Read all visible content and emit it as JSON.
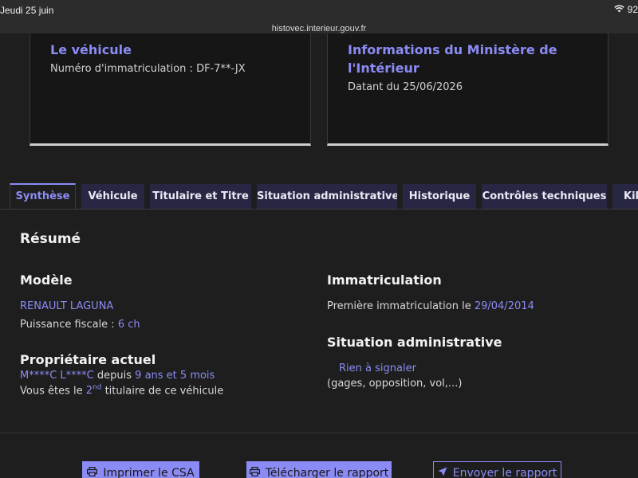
{
  "status_bar": {
    "time": "Jeudi 25 juin",
    "battery": "92"
  },
  "browser": {
    "url": "histovec.interieur.gouv.fr"
  },
  "cards": {
    "vehicle": {
      "title": "Le véhicule",
      "plate_label": "Numéro d'immatriculation : DF-7**-JX"
    },
    "ministry": {
      "title_line1": "Informations du Ministère de",
      "title_line2": "l'Intérieur",
      "date_text": "Datant du 25/06/2026"
    }
  },
  "tabs": [
    {
      "label": "Synthèse",
      "active": true
    },
    {
      "label": "Véhicule"
    },
    {
      "label": "Titulaire et Titre"
    },
    {
      "label": "Situation administrative"
    },
    {
      "label": "Historique"
    },
    {
      "label": "Contrôles techniques"
    },
    {
      "label": "Kilo"
    }
  ],
  "summary": {
    "title": "Résumé",
    "model": {
      "heading": "Modèle",
      "name": "RENAULT LAGUNA",
      "power_label": "Puissance fiscale :",
      "power_value": "6 ch"
    },
    "owner": {
      "heading": "Propriétaire actuel",
      "name": "M****C L****C",
      "since_label": "depuis",
      "since_value": "9 ans et 5 mois",
      "rank_prefix": "Vous êtes le",
      "rank_number": "2",
      "rank_sup": "nd",
      "rank_suffix": "titulaire de ce véhicule"
    },
    "registration": {
      "heading": "Immatriculation",
      "first_label": "Première immatriculation le",
      "first_date": "29/04/2014"
    },
    "admin": {
      "heading": "Situation administrative",
      "status": "Rien à signaler",
      "detail": "(gages, opposition, vol,...)"
    }
  },
  "actions": {
    "print": "Imprimer le CSA",
    "download": "Télécharger le rapport",
    "send": "Envoyer le rapport"
  },
  "colors": {
    "accent": "#8b8bf5",
    "background": "#1e1e1e",
    "tab_bg": "#272744"
  }
}
